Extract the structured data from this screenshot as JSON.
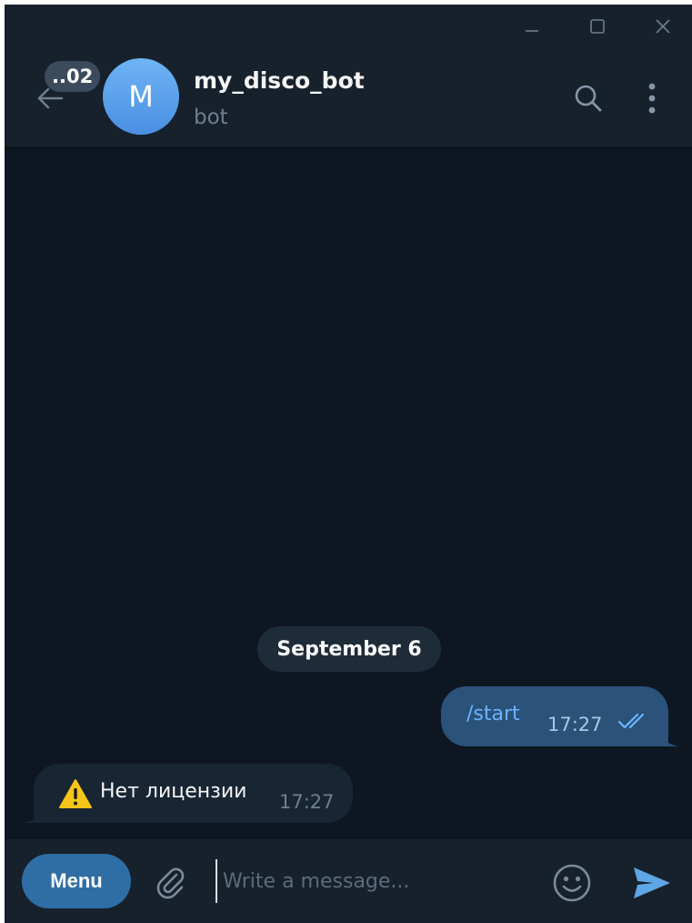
{
  "colors": {
    "window_bg": "#0e1621",
    "header_bg": "#17212b",
    "accent": "#5ea6e6",
    "outgoing_bubble": "#2b5278",
    "incoming_bubble": "#182533",
    "menu_button": "#2f6ea5",
    "warning_yellow": "#f5c518"
  },
  "window_controls": {
    "minimize_icon": "minimize-icon",
    "maximize_icon": "maximize-icon",
    "close_icon": "close-icon"
  },
  "header": {
    "unread_count": "..02",
    "avatar_letter": "M",
    "chat_name": "my_disco_bot",
    "chat_status": "bot",
    "icons": [
      "back-arrow-icon",
      "search-icon",
      "more-vertical-icon"
    ]
  },
  "chat": {
    "date_separator": "September 6",
    "messages": [
      {
        "direction": "outgoing",
        "text": "/start",
        "time": "17:27",
        "status_icon": "double-check-icon"
      },
      {
        "direction": "incoming",
        "icon": "warning-icon",
        "text": "Нет лицензии",
        "time": "17:27"
      }
    ]
  },
  "composer": {
    "menu_label": "Menu",
    "placeholder": "Write a message...",
    "icons": [
      "paperclip-icon",
      "emoji-icon",
      "send-icon"
    ]
  }
}
